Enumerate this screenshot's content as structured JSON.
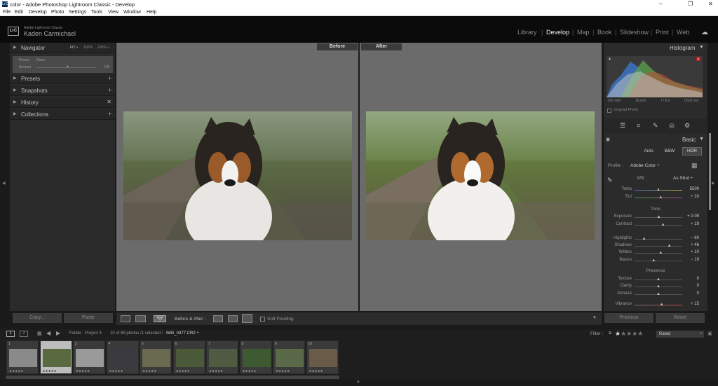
{
  "window": {
    "title": "color - Adobe Photoshop Lightroom Classic - Develop",
    "app_icon": "LrC",
    "controls": [
      "–",
      "❐",
      "✕"
    ]
  },
  "menu": [
    "File",
    "Edit",
    "Develop",
    "Photo",
    "Settings",
    "Tools",
    "View",
    "Window",
    "Help"
  ],
  "identity": {
    "app": "Adobe Lightroom Classic",
    "user": "Kaden Carmichael",
    "badge": "LrC"
  },
  "modules": [
    "Library",
    "Develop",
    "Map",
    "Book",
    "Slideshow",
    "Print",
    "Web"
  ],
  "left": {
    "navigator": {
      "label": "Navigator",
      "zoom": [
        "FIT ÷",
        "100%",
        "200% ÷"
      ]
    },
    "preset_amount": {
      "preset_label": "Preset",
      "preset_value": "None",
      "amount_label": "Amount",
      "amount_value": "100"
    },
    "panels": [
      {
        "label": "Presets",
        "action": "+"
      },
      {
        "label": "Snapshots",
        "action": "+"
      },
      {
        "label": "History",
        "action": "✕"
      },
      {
        "label": "Collections",
        "action": "+"
      }
    ],
    "copy_label": "Copy...",
    "paste_label": "Paste"
  },
  "center": {
    "before_label": "Before",
    "after_label": "After",
    "toolbar": {
      "view_xy": "Y|Y",
      "before_after_label": "Before & After :",
      "soft_proofing": "Soft Proofing"
    }
  },
  "right": {
    "histogram": {
      "label": "Histogram",
      "iso": "ISO 400",
      "focal": "18 mm",
      "aperture": "f / 8.0",
      "shutter": "1/500 sec",
      "original_photo": "Original Photo"
    },
    "basic": {
      "label": "Basic",
      "treatments": [
        "Auto",
        "B&W",
        "HDR"
      ],
      "profile_label": "Profile :",
      "profile_value": "Adobe Color ÷",
      "wb_label": "WB :",
      "wb_value": "As Shot ÷",
      "tone_label": "Tone",
      "presence_label": "Presence",
      "sliders": [
        {
          "name": "Temp",
          "value": "5500",
          "pos": 0.5
        },
        {
          "name": "Tint",
          "value": "+ 20",
          "pos": 0.55
        },
        {
          "name": "Exposure",
          "value": "+ 0.09",
          "pos": 0.51
        },
        {
          "name": "Contrast",
          "value": "+ 19",
          "pos": 0.6
        },
        {
          "name": "Highlights",
          "value": "− 60",
          "pos": 0.2
        },
        {
          "name": "Shadows",
          "value": "+ 46",
          "pos": 0.73
        },
        {
          "name": "Whites",
          "value": "+ 10",
          "pos": 0.55
        },
        {
          "name": "Blacks",
          "value": "− 19",
          "pos": 0.4
        },
        {
          "name": "Texture",
          "value": "0",
          "pos": 0.5
        },
        {
          "name": "Clarity",
          "value": "0",
          "pos": 0.5
        },
        {
          "name": "Dehaze",
          "value": "0",
          "pos": 0.5
        },
        {
          "name": "Vibrance",
          "value": "+ 15",
          "pos": 0.57
        }
      ]
    },
    "previous_label": "Previous",
    "reset_label": "Reset"
  },
  "filmstrip": {
    "pages": [
      "1",
      "2"
    ],
    "source": "Folder : Project 3",
    "count": "10 of 89 photos /1 selected /",
    "filename": "IMG_0477.CR2 ÷",
    "filter_label": "Filter :",
    "rating_op": "≥",
    "rated_value": "Rated",
    "thumb_numbers": [
      "1",
      "2",
      "3",
      "4",
      "5",
      "6",
      "7",
      "8",
      "9",
      "10"
    ],
    "stars": "★★★★★"
  },
  "colors": {
    "accent": "#cfcfcf",
    "panel": "#2b2b2b",
    "center_bg": "#6b6b6b"
  }
}
